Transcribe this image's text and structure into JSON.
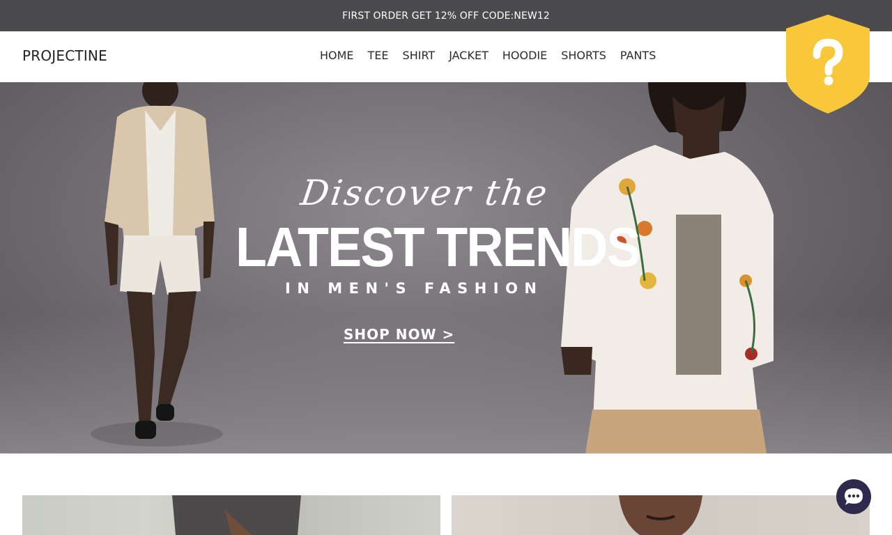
{
  "announcement": {
    "text": "FIRST ORDER GET 12% OFF CODE:NEW12"
  },
  "header": {
    "logo": "PROJECTINE",
    "nav": [
      {
        "label": "HOME"
      },
      {
        "label": "TEE"
      },
      {
        "label": "SHIRT"
      },
      {
        "label": "JACKET"
      },
      {
        "label": "HOODIE"
      },
      {
        "label": "SHORTS"
      },
      {
        "label": "PANTS"
      }
    ]
  },
  "badge": {
    "icon": "question-shield-icon",
    "color": "#f8c83a"
  },
  "hero": {
    "script": "Discover the",
    "title": "LATEST TRENDS",
    "subtitle": "IN MEN'S FASHION",
    "cta": "SHOP NOW >"
  },
  "chat": {
    "icon": "chat-bubble-icon",
    "color": "#2f2a4d"
  },
  "colors": {
    "announcement_bg": "#4b4a4d",
    "text": "#2a2a2a"
  }
}
